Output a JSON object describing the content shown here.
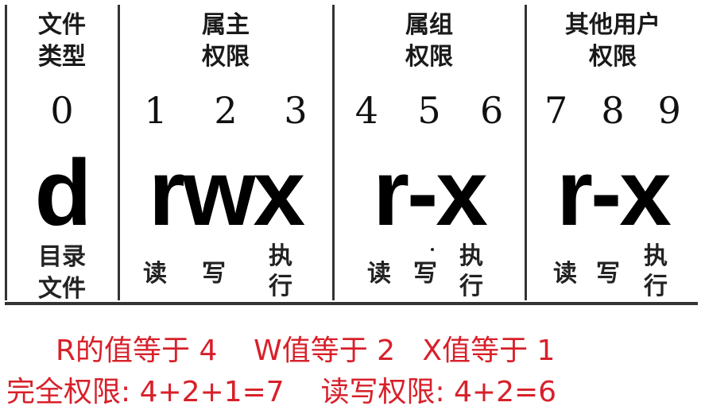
{
  "columns": [
    {
      "header": "文件\n类型",
      "digits": [
        "0"
      ],
      "perm": "d",
      "sub": "目录\n文件"
    },
    {
      "header": "属主\n权限",
      "digits": [
        "1",
        "2",
        "3"
      ],
      "perm": "rwx",
      "ops": [
        "读",
        "写",
        "执\n行"
      ]
    },
    {
      "header": "属组\n权限",
      "digits": [
        "4",
        "5",
        "6"
      ],
      "perm": "r-x",
      "ops": [
        "读",
        "写",
        "执\n行"
      ]
    },
    {
      "header": "其他用户\n权限",
      "digits": [
        "7",
        "8",
        "9"
      ],
      "perm": "r-x",
      "ops": [
        "读",
        "写",
        "执\n行"
      ]
    }
  ],
  "notes": {
    "line1": "R的值等于 4    W值等于 2   X值等于 1",
    "line2": "完全权限: 4+2+1=7    读写权限: 4+2=6"
  }
}
